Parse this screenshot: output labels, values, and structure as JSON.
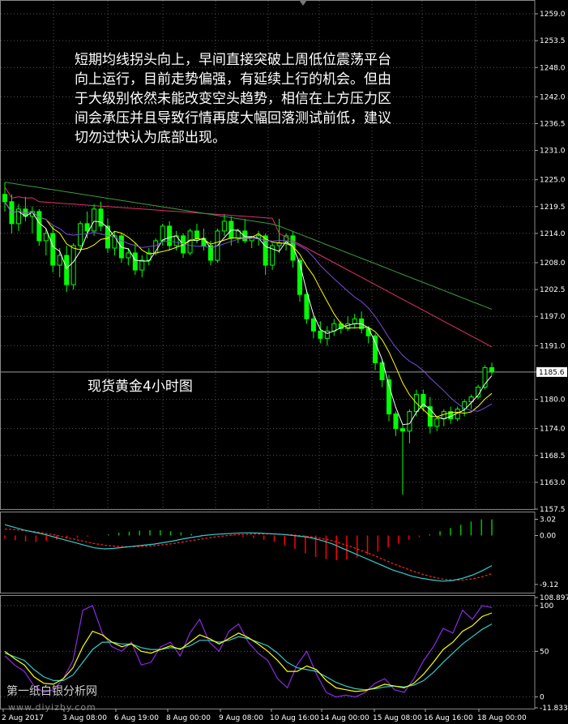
{
  "annotation_text": "短期均线拐头向上，早间直接突破上周低位震荡平台\n向上运行，目前走势偏强，有延续上行的机会。但由\n于大级别依然未能改变空头趋势，相信在上方压力区\n间会承压并且导致行情再度大幅回落测试前低，建议\n切勿过快认为底部出现。",
  "chart_label": "现货黄金4小时图",
  "watermark": "第一纸白银分析网",
  "watermark_url": "www.diyizby.com",
  "colors": {
    "background": "#000000",
    "grid": "#555555",
    "axis_text": "#ffffff",
    "bull": "#00ff00",
    "bear": "#00ff00",
    "ma_fast": "#ffffff",
    "ma_mid": "#ffff00",
    "ma_slow": "#7b4dd8",
    "ma_pink": "#e0306c",
    "ma_green": "#3c9c3c",
    "macd_bars_neg": "#ff0000",
    "macd_bars_pos": "#00c000",
    "macd_signal": "#ff2020",
    "macd_line": "#33cccc",
    "stoch_main": "#8a2be2",
    "stoch_k": "#ffff00",
    "stoch_d": "#33cccc"
  },
  "chart_data": [
    {
      "type": "candlestick",
      "title": "",
      "y_ticks": [
        "1259.0",
        "1253.5",
        "1248.0",
        "1242.0",
        "1236.5",
        "1231.0",
        "1225.0",
        "1219.5",
        "1214.0",
        "1208.0",
        "1202.5",
        "1197.0",
        "1191.0",
        "1185.6",
        "1180.0",
        "1174.0",
        "1168.5",
        "1163.0",
        "1157.5"
      ],
      "current_price": "1185.6",
      "ylim": [
        1157.5,
        1261
      ],
      "x_ticks": [
        "2 Aug 2017",
        "3 Aug 08:00",
        "6 Aug 19:00",
        "8 Aug 00:00",
        "9 Aug 08:00",
        "10 Aug 16:00",
        "14 Aug 00:00",
        "15 Aug 08:00",
        "16 Aug 16:00",
        "18 Aug 00:00"
      ],
      "ohlc": [
        [
          1222.0,
          1224.5,
          1218.5,
          1220.5
        ],
        [
          1220.5,
          1222.0,
          1214.0,
          1216.0
        ],
        [
          1216.0,
          1220.0,
          1214.5,
          1219.0
        ],
        [
          1219.0,
          1221.5,
          1216.5,
          1217.5
        ],
        [
          1217.5,
          1219.5,
          1214.0,
          1218.5
        ],
        [
          1218.5,
          1219.0,
          1211.5,
          1212.5
        ],
        [
          1212.5,
          1215.0,
          1209.5,
          1214.0
        ],
        [
          1214.0,
          1215.5,
          1206.0,
          1207.5
        ],
        [
          1207.5,
          1211.0,
          1205.0,
          1209.5
        ],
        [
          1209.5,
          1211.5,
          1202.0,
          1203.5
        ],
        [
          1203.5,
          1212.0,
          1202.5,
          1211.5
        ],
        [
          1211.5,
          1216.5,
          1210.5,
          1216.0
        ],
        [
          1216.0,
          1218.5,
          1213.0,
          1214.5
        ],
        [
          1214.5,
          1220.0,
          1213.5,
          1219.0
        ],
        [
          1219.0,
          1220.5,
          1214.5,
          1215.5
        ],
        [
          1215.5,
          1217.0,
          1210.0,
          1211.0
        ],
        [
          1211.0,
          1214.5,
          1209.5,
          1213.5
        ],
        [
          1213.5,
          1214.0,
          1208.0,
          1209.0
        ],
        [
          1209.0,
          1211.0,
          1207.5,
          1210.0
        ],
        [
          1210.0,
          1212.0,
          1205.5,
          1206.5
        ],
        [
          1206.5,
          1209.5,
          1205.0,
          1208.5
        ],
        [
          1208.5,
          1211.0,
          1207.5,
          1210.0
        ],
        [
          1210.0,
          1213.0,
          1209.5,
          1212.5
        ],
        [
          1212.5,
          1216.0,
          1211.5,
          1215.5
        ],
        [
          1215.5,
          1216.5,
          1210.5,
          1211.5
        ],
        [
          1211.5,
          1214.5,
          1210.5,
          1213.5
        ],
        [
          1213.5,
          1214.0,
          1209.0,
          1210.0
        ],
        [
          1210.0,
          1215.0,
          1209.5,
          1214.5
        ],
        [
          1214.5,
          1216.0,
          1212.0,
          1213.0
        ],
        [
          1213.0,
          1215.0,
          1210.5,
          1211.5
        ],
        [
          1211.5,
          1212.5,
          1207.5,
          1208.5
        ],
        [
          1208.5,
          1215.0,
          1208.0,
          1214.5
        ],
        [
          1214.5,
          1218.0,
          1213.5,
          1216.5
        ],
        [
          1216.5,
          1217.5,
          1211.5,
          1213.0
        ],
        [
          1213.0,
          1215.0,
          1212.0,
          1214.5
        ],
        [
          1214.5,
          1217.0,
          1212.0,
          1212.5
        ],
        [
          1212.5,
          1213.5,
          1211.0,
          1213.0
        ],
        [
          1213.0,
          1214.5,
          1211.5,
          1213.5
        ],
        [
          1213.5,
          1214.0,
          1205.5,
          1207.5
        ],
        [
          1207.5,
          1212.0,
          1206.5,
          1211.5
        ],
        [
          1211.5,
          1217.0,
          1210.0,
          1212.0
        ],
        [
          1212.0,
          1214.0,
          1210.5,
          1213.5
        ],
        [
          1213.5,
          1214.5,
          1207.0,
          1208.5
        ],
        [
          1208.5,
          1209.0,
          1200.0,
          1201.5
        ],
        [
          1201.5,
          1202.5,
          1195.5,
          1196.5
        ],
        [
          1196.5,
          1197.0,
          1192.5,
          1194.0
        ],
        [
          1194.0,
          1196.0,
          1191.5,
          1192.5
        ],
        [
          1192.5,
          1195.0,
          1191.0,
          1194.0
        ],
        [
          1194.0,
          1196.5,
          1193.0,
          1195.5
        ],
        [
          1195.5,
          1196.0,
          1193.5,
          1194.5
        ],
        [
          1194.5,
          1197.0,
          1194.0,
          1195.5
        ],
        [
          1195.5,
          1197.5,
          1194.5,
          1196.5
        ],
        [
          1196.5,
          1198.0,
          1193.5,
          1194.5
        ],
        [
          1194.5,
          1195.0,
          1191.5,
          1193.0
        ],
        [
          1193.0,
          1193.5,
          1186.0,
          1187.5
        ],
        [
          1187.5,
          1188.0,
          1182.5,
          1184.0
        ],
        [
          1184.0,
          1185.0,
          1175.5,
          1177.0
        ],
        [
          1177.0,
          1177.5,
          1172.5,
          1174.0
        ],
        [
          1174.0,
          1175.0,
          1160.5,
          1173.5
        ],
        [
          1173.5,
          1178.0,
          1171.0,
          1177.5
        ],
        [
          1177.5,
          1182.0,
          1176.5,
          1181.0
        ],
        [
          1181.0,
          1182.0,
          1177.5,
          1178.5
        ],
        [
          1178.5,
          1180.5,
          1173.0,
          1174.5
        ],
        [
          1174.5,
          1176.5,
          1173.5,
          1176.0
        ],
        [
          1176.0,
          1178.0,
          1174.5,
          1177.5
        ],
        [
          1177.5,
          1178.5,
          1175.0,
          1176.0
        ],
        [
          1176.0,
          1178.5,
          1175.5,
          1178.0
        ],
        [
          1178.0,
          1180.0,
          1176.5,
          1179.5
        ],
        [
          1179.5,
          1181.0,
          1178.0,
          1180.5
        ],
        [
          1180.5,
          1183.0,
          1180.0,
          1182.5
        ],
        [
          1182.5,
          1187.0,
          1182.0,
          1186.5
        ],
        [
          1186.5,
          1187.5,
          1185.0,
          1185.6
        ]
      ]
    },
    {
      "type": "macd",
      "y_ticks": [
        "3.02",
        "0.00",
        "-9.12"
      ],
      "ylim": [
        -10.5,
        4.0
      ],
      "main": [
        2.0,
        1.5,
        1.0,
        0.6,
        0.2,
        -0.3,
        -0.8,
        -1.3,
        -1.8,
        -2.3,
        -2.5,
        -2.4,
        -2.2,
        -2.0,
        -1.8,
        -1.6,
        -1.3,
        -1.0,
        -0.6,
        -0.3,
        0.0,
        0.2,
        0.3,
        0.4,
        0.5,
        0.5,
        0.4,
        0.3,
        0.2,
        0.0,
        -0.2,
        -0.5,
        -1.0,
        -1.6,
        -2.4,
        -3.2,
        -4.0,
        -4.8,
        -5.6,
        -6.4,
        -7.0,
        -7.6,
        -8.0,
        -8.3,
        -8.5,
        -8.4,
        -8.0,
        -7.4,
        -6.6,
        -5.6
      ],
      "signal": [
        1.2,
        1.1,
        0.9,
        0.7,
        0.4,
        0.1,
        -0.3,
        -0.7,
        -1.1,
        -1.5,
        -1.8,
        -2.0,
        -2.1,
        -2.1,
        -2.0,
        -1.9,
        -1.7,
        -1.5,
        -1.2,
        -0.9,
        -0.6,
        -0.3,
        -0.1,
        0.1,
        0.2,
        0.3,
        0.3,
        0.3,
        0.2,
        0.1,
        -0.1,
        -0.3,
        -0.6,
        -1.0,
        -1.6,
        -2.2,
        -2.9,
        -3.6,
        -4.4,
        -5.2,
        -5.9,
        -6.6,
        -7.2,
        -7.7,
        -8.1,
        -8.3,
        -8.3,
        -8.1,
        -7.7,
        -7.1
      ],
      "histogram": [
        -0.6,
        -0.9,
        -1.1,
        -1.2,
        -1.0,
        -0.8,
        -0.6,
        -0.4,
        -0.2,
        0.0,
        0.2,
        0.5,
        0.7,
        0.9,
        1.0,
        1.0,
        0.8,
        0.6,
        0.3,
        0.1,
        0.0,
        0.0,
        -0.1,
        -0.3,
        -0.5,
        -0.8,
        -1.2,
        -1.8,
        -2.5,
        -3.3,
        -4.0,
        -4.4,
        -4.6,
        -4.5,
        -4.1,
        -3.6,
        -3.0,
        -2.2,
        -1.5,
        -0.8,
        -0.3,
        0.2,
        0.8,
        1.4,
        2.0,
        2.6,
        3.0,
        3.0
      ]
    },
    {
      "type": "stochastic",
      "y_ticks": [
        "108.8973",
        "100",
        "50",
        "0",
        "-11.8338"
      ],
      "ylim": [
        -11.8338,
        108.8973
      ],
      "main": [
        45,
        35,
        28,
        12,
        5,
        8,
        20,
        40,
        95,
        100,
        70,
        55,
        50,
        60,
        35,
        38,
        55,
        60,
        45,
        70,
        85,
        60,
        50,
        72,
        80,
        60,
        48,
        40,
        20,
        10,
        35,
        50,
        25,
        5,
        0,
        2,
        0,
        5,
        15,
        20,
        8,
        5,
        20,
        40,
        55,
        75,
        70,
        95,
        85,
        100,
        98
      ],
      "k": [
        50,
        42,
        35,
        22,
        15,
        14,
        20,
        32,
        55,
        72,
        68,
        60,
        55,
        58,
        50,
        48,
        52,
        56,
        52,
        60,
        68,
        64,
        58,
        64,
        70,
        65,
        58,
        50,
        40,
        28,
        28,
        34,
        30,
        18,
        10,
        8,
        6,
        7,
        10,
        14,
        12,
        10,
        15,
        25,
        38,
        52,
        60,
        72,
        78,
        88,
        92
      ],
      "d": [
        48,
        44,
        40,
        30,
        22,
        18,
        18,
        24,
        38,
        52,
        60,
        60,
        58,
        58,
        54,
        52,
        52,
        54,
        53,
        56,
        62,
        62,
        60,
        62,
        66,
        64,
        60,
        56,
        48,
        38,
        32,
        30,
        28,
        22,
        16,
        12,
        9,
        8,
        9,
        11,
        12,
        11,
        13,
        18,
        27,
        38,
        48,
        58,
        66,
        74,
        80
      ]
    }
  ]
}
